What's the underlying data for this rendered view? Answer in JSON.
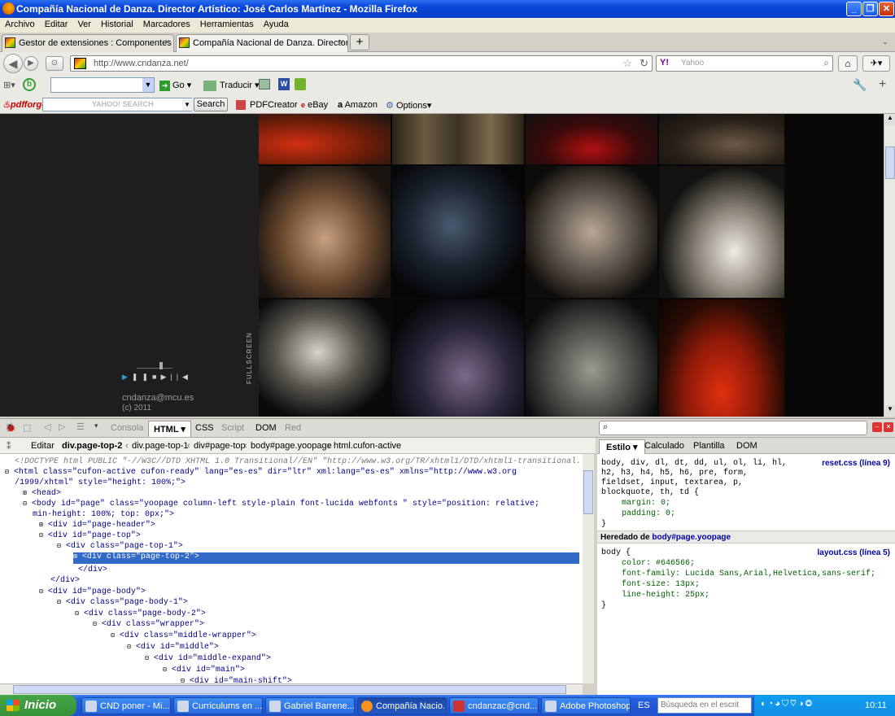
{
  "window": {
    "title": "Compañía Nacional de Danza. Director Artístico: José Carlos Martínez - Mozilla Firefox",
    "min": "_",
    "max": "❐",
    "close": "✕"
  },
  "menu": [
    "Archivo",
    "Editar",
    "Ver",
    "Historial",
    "Marcadores",
    "Herramientas",
    "Ayuda"
  ],
  "tabs": [
    {
      "label": "Gestor de extensiones : Componentes"
    },
    {
      "label": "Compañía Nacional de Danza. Director Ar..."
    }
  ],
  "tab_close": "×",
  "new_tab": "+",
  "nav": {
    "url": "http://www.cndanza.net/",
    "search_engine": "Y!",
    "search_placeholder": "Yahoo"
  },
  "toolbar2": {
    "go": "Go",
    "translate": "Traducir"
  },
  "toolbar3": {
    "brand": "pdfforge",
    "search_placeholder": "YAHOO! SEARCH",
    "search_button": "Search",
    "pdfcreator": "PDFCreator",
    "ebay": "eBay",
    "amazon": "Amazon",
    "options": "Options"
  },
  "site": {
    "email": "cndanza@mcu.es",
    "copyright": "(c) 2011",
    "fullscreen": "FULLSCREEN"
  },
  "firebug": {
    "tabs": [
      "Consola",
      "HTML",
      "CSS",
      "Script",
      "DOM",
      "Red"
    ],
    "edit": "Editar",
    "path": [
      "div.page-top-2",
      "div.page-top-1",
      "div#page-top",
      "body#page.yoopage",
      "html.cufon-active"
    ],
    "side_tabs": [
      "Estilo",
      "Calculado",
      "Plantilla",
      "DOM"
    ],
    "html_lines": [
      "<!DOCTYPE html PUBLIC \"-//W3C//DTD XHTML 1.0 Transitional//EN\" \"http://www.w3.org/TR/xhtml1/DTD/xhtml1-transitional.",
      "<html class=\"cufon-active cufon-ready\" lang=\"es-es\" dir=\"ltr\" xml:lang=\"es-es\" xmlns=\"http://www.w3.org",
      "/1999/xhtml\" style=\"height: 100%;\">",
      "<head>",
      "<body id=\"page\" class=\"yoopage column-left style-plain font-lucida webfonts \" style=\"position: relative;",
      "min-height: 100%; top: 0px;\">",
      "<div id=\"page-header\">",
      "<div id=\"page-top\">",
      "<div class=\"page-top-1\">",
      "<div class=\"page-top-2\">",
      "</div>",
      "</div>",
      "<div id=\"page-body\">",
      "<div class=\"page-body-1\">",
      "<div class=\"page-body-2\">",
      "<div class=\"wrapper\">",
      "<div class=\"middle-wrapper\">",
      "<div id=\"middle\">",
      "<div id=\"middle-expand\">",
      "<div id=\"main\">",
      "<div id=\"main-shift\">"
    ],
    "css_rule1": {
      "selector": "body, div, dl, dt, dd, ul, ol, li, hl,",
      "selector2": "h2, h3, h4, h5, h6, pre, form,",
      "selector3": "fieldset, input, textarea, p,",
      "selector4": "blockquote, th, td {",
      "p1": "margin: 0;",
      "p2": "padding: 0;",
      "close": "}",
      "source": "reset.css (línea 9)"
    },
    "inherited_label": "Heredado de",
    "inherited_from": "body#page.yoopage",
    "css_rule2": {
      "selector": "body {",
      "p1": "color: #646566;",
      "p2": "font-family: Lucida Sans,Arial,Helvetica,sans-serif;",
      "p3": "font-size: 13px;",
      "p4": "line-height: 25px;",
      "close": "}",
      "source": "layout.css (línea 5)"
    }
  },
  "taskbar": {
    "start": "Inicio",
    "tasks": [
      "CND poner - Mi...",
      "Curriculums en ...",
      "Gabriel Barrene...",
      "Compañía Nacio...",
      "cndanzac@cnd...",
      "Adobe Photoshop"
    ],
    "lang": "ES",
    "search_placeholder": "Búsqueda en el escrit",
    "clock": "10:11"
  },
  "colors": {
    "accent": "#316ac5",
    "xp_blue": "#245edb",
    "start_green": "#37913a"
  }
}
